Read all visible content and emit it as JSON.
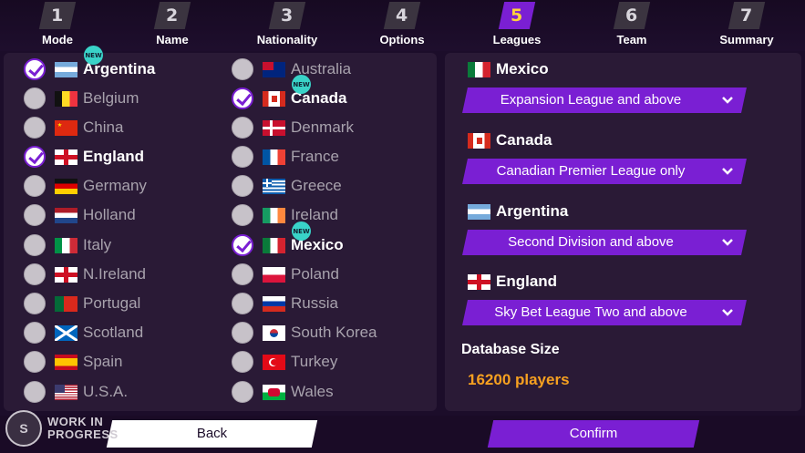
{
  "steps": [
    {
      "num": "1",
      "label": "Mode"
    },
    {
      "num": "2",
      "label": "Name"
    },
    {
      "num": "3",
      "label": "Nationality"
    },
    {
      "num": "4",
      "label": "Options"
    },
    {
      "num": "5",
      "label": "Leagues"
    },
    {
      "num": "6",
      "label": "Team"
    },
    {
      "num": "7",
      "label": "Summary"
    }
  ],
  "active_step": "5",
  "countries_left": [
    {
      "name": "Argentina",
      "checked": true,
      "new": true
    },
    {
      "name": "Belgium",
      "checked": false,
      "new": false
    },
    {
      "name": "China",
      "checked": false,
      "new": false
    },
    {
      "name": "England",
      "checked": true,
      "new": false
    },
    {
      "name": "Germany",
      "checked": false,
      "new": false
    },
    {
      "name": "Holland",
      "checked": false,
      "new": false
    },
    {
      "name": "Italy",
      "checked": false,
      "new": false
    },
    {
      "name": "N.Ireland",
      "checked": false,
      "new": false
    },
    {
      "name": "Portugal",
      "checked": false,
      "new": false
    },
    {
      "name": "Scotland",
      "checked": false,
      "new": false
    },
    {
      "name": "Spain",
      "checked": false,
      "new": false
    },
    {
      "name": "U.S.A.",
      "checked": false,
      "new": false
    }
  ],
  "countries_right": [
    {
      "name": "Australia",
      "checked": false,
      "new": false
    },
    {
      "name": "Canada",
      "checked": true,
      "new": true
    },
    {
      "name": "Denmark",
      "checked": false,
      "new": false
    },
    {
      "name": "France",
      "checked": false,
      "new": false
    },
    {
      "name": "Greece",
      "checked": false,
      "new": false
    },
    {
      "name": "Ireland",
      "checked": false,
      "new": false
    },
    {
      "name": "Mexico",
      "checked": true,
      "new": true
    },
    {
      "name": "Poland",
      "checked": false,
      "new": false
    },
    {
      "name": "Russia",
      "checked": false,
      "new": false
    },
    {
      "name": "South Korea",
      "checked": false,
      "new": false
    },
    {
      "name": "Turkey",
      "checked": false,
      "new": false
    },
    {
      "name": "Wales",
      "checked": false,
      "new": false
    }
  ],
  "new_badge": "NEW",
  "leagues": [
    {
      "country": "Mexico",
      "selection": "Expansion League and above"
    },
    {
      "country": "Canada",
      "selection": "Canadian Premier League only"
    },
    {
      "country": "Argentina",
      "selection": "Second Division and above"
    },
    {
      "country": "England",
      "selection": "Sky Bet League Two and above"
    }
  ],
  "database": {
    "title": "Database Size",
    "value": "16200 players"
  },
  "buttons": {
    "back": "Back",
    "confirm": "Confirm"
  },
  "watermark": {
    "logo": "S",
    "line1": "WORK IN",
    "line2": "PROGRESS"
  },
  "colors": {
    "accent": "#7a1fd3",
    "active_step_number": "#ffd33a",
    "db_value": "#f6a020",
    "new_badge": "#39d3c8"
  }
}
